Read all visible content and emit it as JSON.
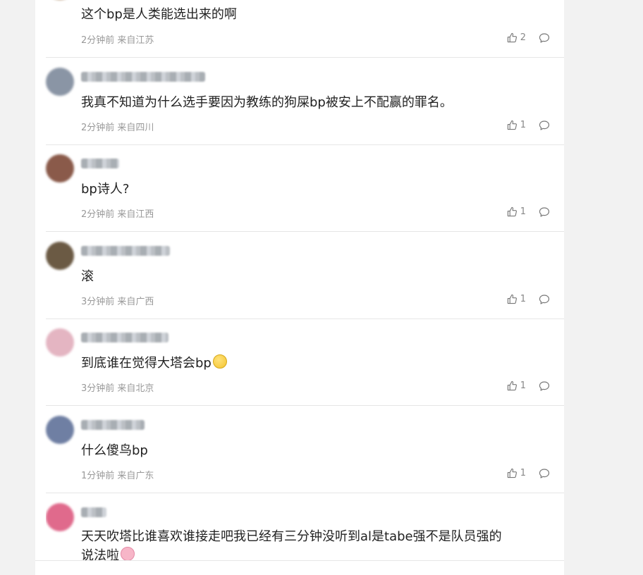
{
  "comments": [
    {
      "text": "这个bp是人类能选出来的啊",
      "meta": "2分钟前 来自江苏",
      "likes": "2",
      "avatar_color": "#b89a7a"
    },
    {
      "text": "我真不知道为什么选手要因为教练的狗屎bp被安上不配赢的罪名。",
      "meta": "2分钟前 来自四川",
      "likes": "1",
      "avatar_color": "#8a95a5"
    },
    {
      "text": "bp诗人?",
      "meta": "2分钟前 来自江西",
      "likes": "1",
      "avatar_color": "#8a5a4a"
    },
    {
      "text": "滚",
      "meta": "3分钟前 来自广西",
      "likes": "1",
      "avatar_color": "#6b5a44"
    },
    {
      "text": "到底谁在觉得大塔会bp",
      "meta": "3分钟前 来自北京",
      "likes": "1",
      "avatar_color": "#e4b5c2"
    },
    {
      "text": "什么傻鸟bp",
      "meta": "1分钟前 来自广东",
      "likes": "1",
      "avatar_color": "#6f7fa3"
    },
    {
      "text_line1": "天天吹塔比谁喜欢谁接走吧我已经有三分钟没听到al是tabe强不是队员强的",
      "text_line2": "说法啦",
      "avatar_color": "#e06a8c"
    }
  ]
}
